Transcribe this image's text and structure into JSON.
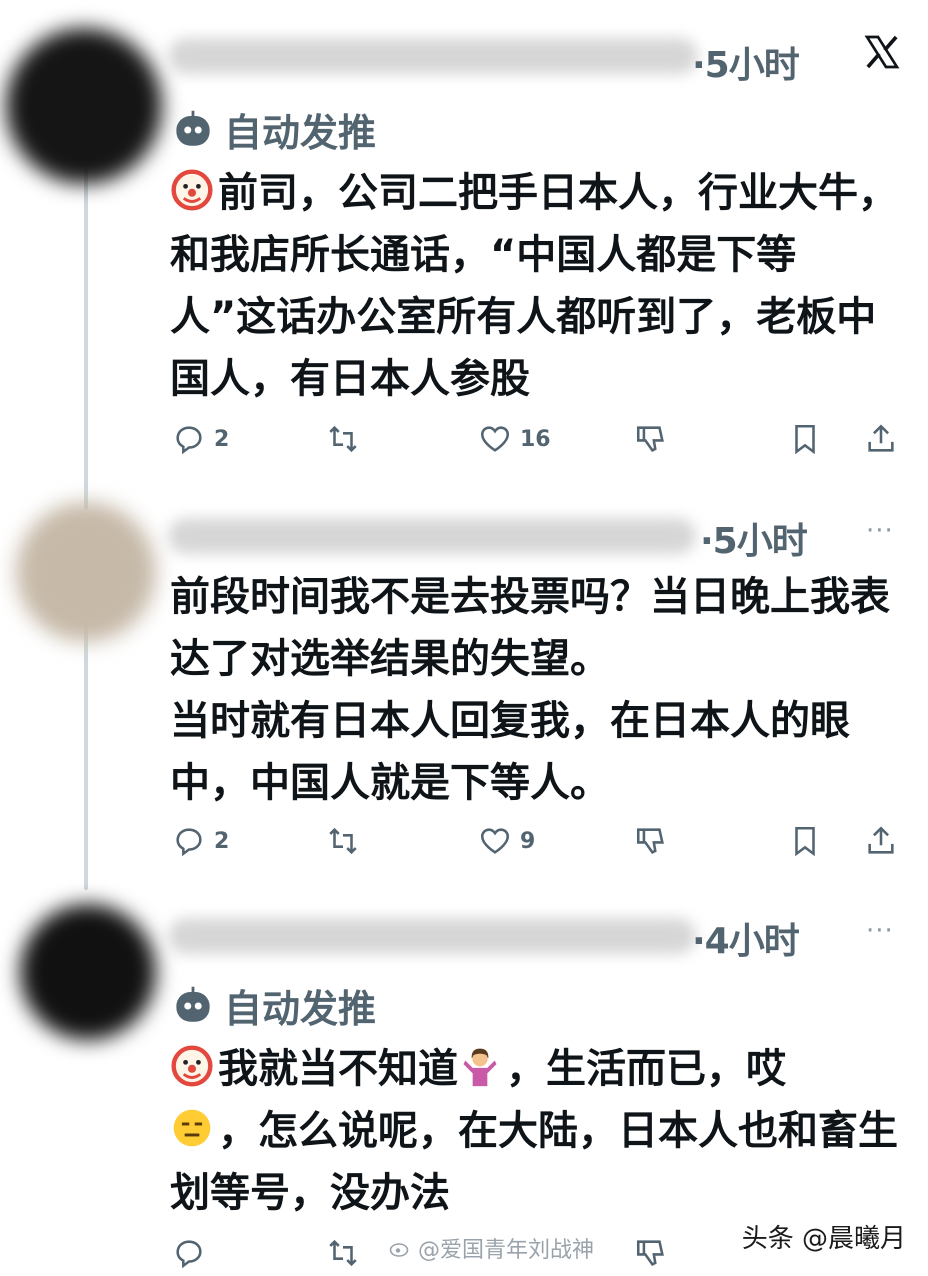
{
  "posts": [
    {
      "time": "·5小时",
      "auto_tag": "自动发推",
      "body": [
        "前司，公司二把手日本人，行业大牛，和我店所长通话，“中国人都是下等人”这话办公室所有人都听到了，老板中国人，有日本人参股"
      ],
      "leading_emoji": "clown-face",
      "actions": {
        "reply_count": "2",
        "retweet_count": "",
        "like_count": "16"
      }
    },
    {
      "time": "·5小时",
      "body": [
        "前段时间我不是去投票吗？当日晚上我表达了对选举结果的失望。",
        "当时就有日本人回复我，在日本人的眼中，中国人就是下等人。"
      ],
      "actions": {
        "reply_count": "2",
        "retweet_count": "",
        "like_count": "9"
      }
    },
    {
      "time": "·4小时",
      "auto_tag": "自动发推",
      "body_parts": [
        "我就当不知道",
        "，生活而已，哎",
        "，怎么说呢，在大陆，日本人也和畜生划等号，没办法"
      ],
      "emojis": [
        "clown-face",
        "shrugging-woman",
        "expressionless-face"
      ]
    }
  ],
  "more_glyph": "···",
  "watermark_center": "@爱国青年刘战神",
  "watermark_right": "头条 @晨曦月",
  "colors": {
    "text": "#0f1419",
    "muted": "#536471",
    "thread_line": "#cfd9de"
  }
}
